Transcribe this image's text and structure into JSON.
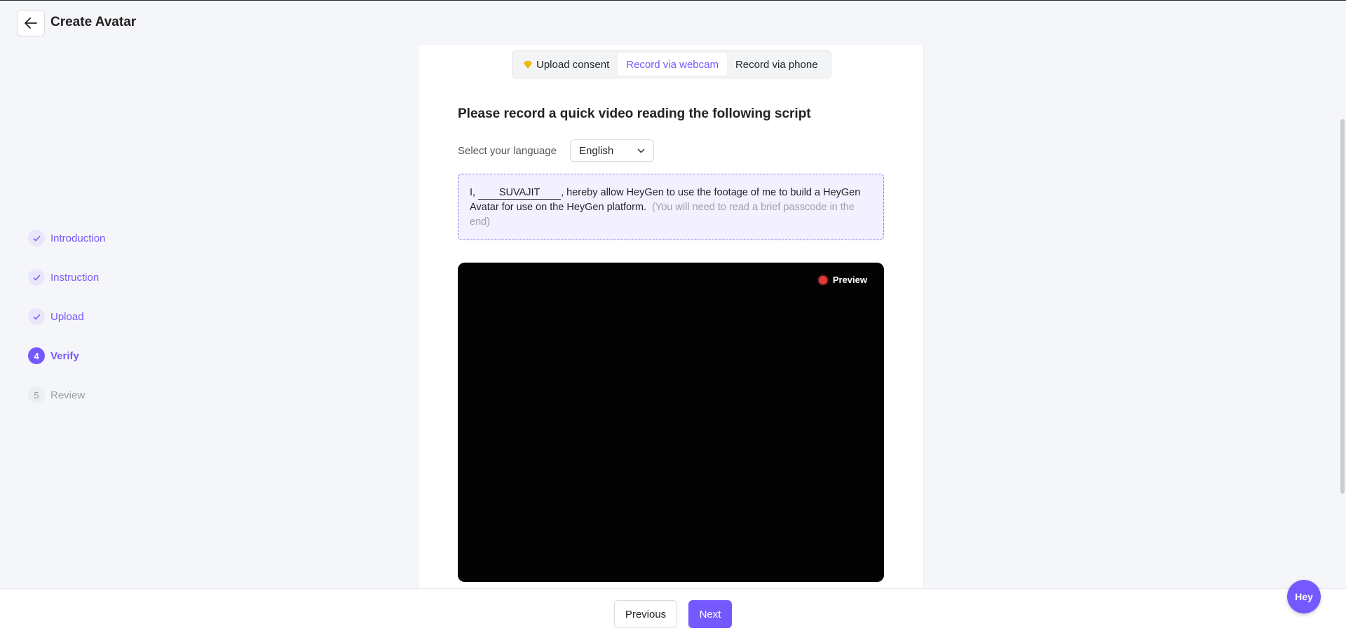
{
  "header": {
    "title": "Create Avatar"
  },
  "steps": [
    {
      "label": "Introduction",
      "status": "done",
      "marker": ""
    },
    {
      "label": "Instruction",
      "status": "done",
      "marker": ""
    },
    {
      "label": "Upload",
      "status": "done",
      "marker": ""
    },
    {
      "label": "Verify",
      "status": "active",
      "marker": "4"
    },
    {
      "label": "Review",
      "status": "todo",
      "marker": "5"
    }
  ],
  "tabs": [
    {
      "label": "Upload consent",
      "icon": "gem-icon",
      "selected": false
    },
    {
      "label": "Record via webcam",
      "selected": true
    },
    {
      "label": "Record via phone",
      "selected": false
    }
  ],
  "main": {
    "heading": "Please record a quick video reading the following script",
    "language_label": "Select your language",
    "language_value": "English",
    "script": {
      "prefix": "I, ",
      "name": "SUVAJIT",
      "body": ", hereby allow HeyGen to use the footage of me to build a HeyGen Avatar for use on the HeyGen platform.",
      "note": "(You will need to read a brief passcode in the end)"
    },
    "video": {
      "preview_label": "Preview"
    }
  },
  "footer": {
    "previous_label": "Previous",
    "next_label": "Next"
  },
  "chat": {
    "label": "Hey"
  },
  "colors": {
    "accent": "#7559ff",
    "record": "#e53935",
    "script_bg": "#f3f1ff"
  }
}
